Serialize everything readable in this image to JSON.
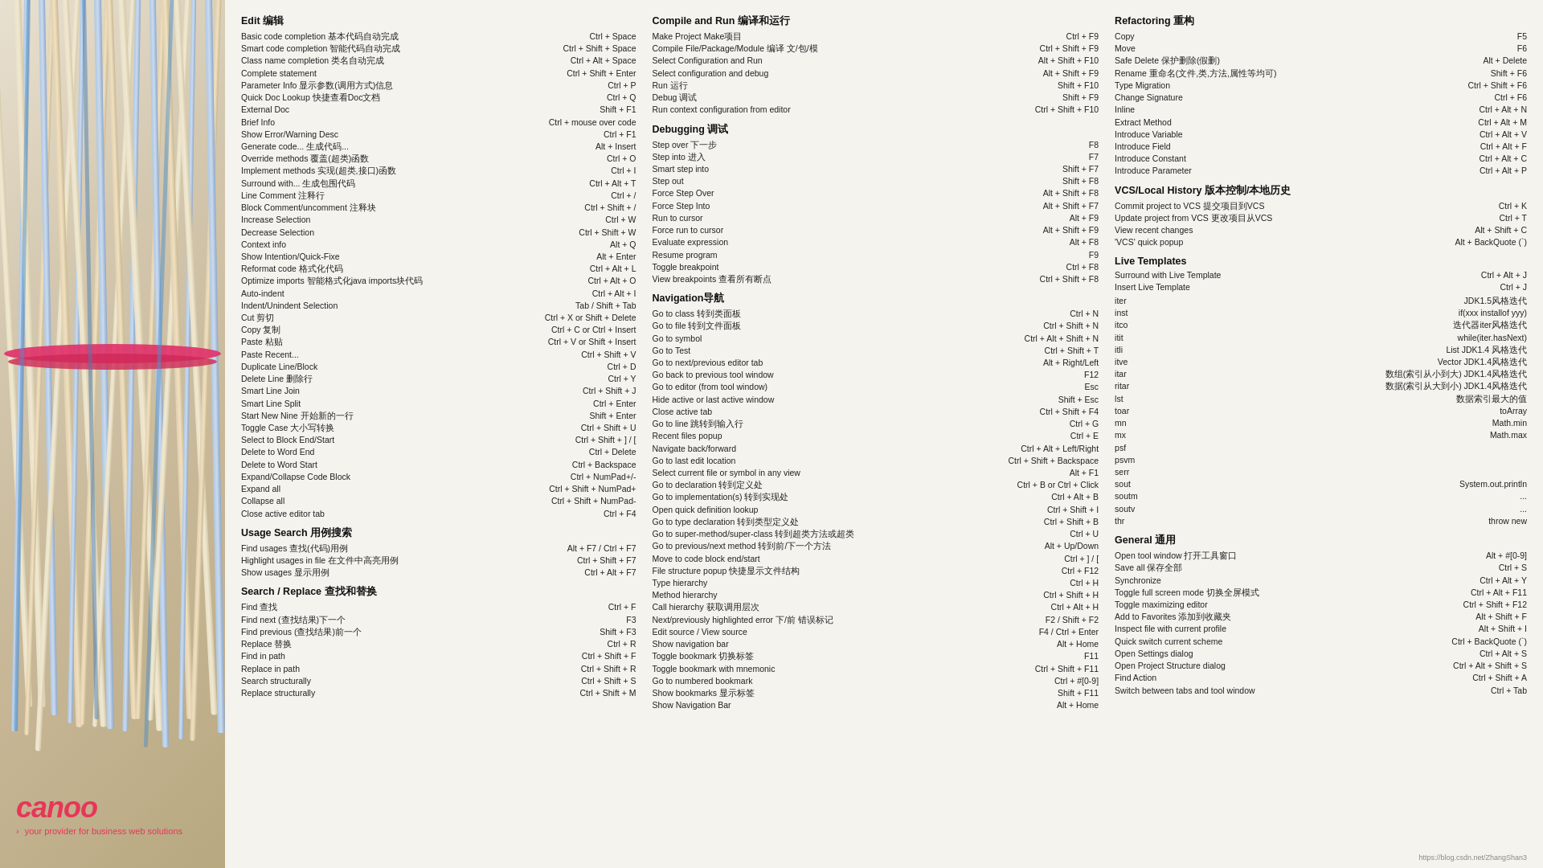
{
  "logo": {
    "text": "canoo",
    "tagline": "your provider for business web solutions",
    "arrow": "›"
  },
  "url": "https://blog.csdn.net/ZhangShan3",
  "columns": {
    "col1": {
      "title": "Edit 编辑",
      "items": [
        {
          "desc": "Basic code completion  基本代码自动完成",
          "key": "Ctrl + Space"
        },
        {
          "desc": "Smart code completion  智能代码自动完成",
          "key": "Ctrl + Shift + Space"
        },
        {
          "desc": "Class name completion  类名自动完成",
          "key": "Ctrl + Alt + Space"
        },
        {
          "desc": "Complete statement",
          "key": "Ctrl + Shift + Enter"
        },
        {
          "desc": "Parameter Info  显示参数(调用方式)信息",
          "key": "Ctrl + P"
        },
        {
          "desc": "Quick Doc Lookup  快捷查看Doc文档",
          "key": "Ctrl + Q"
        },
        {
          "desc": "External Doc",
          "key": "Shift + F1"
        },
        {
          "desc": "Brief Info",
          "key": "Ctrl + mouse over code"
        },
        {
          "desc": "Show Error/Warning Desc",
          "key": "Ctrl + F1"
        },
        {
          "desc": "Generate code...  生成代码...",
          "key": "Alt + Insert"
        },
        {
          "desc": "Override methods  覆盖(超类)函数",
          "key": "Ctrl + O"
        },
        {
          "desc": "Implement methods  实现(超类,接口)函数",
          "key": "Ctrl + I"
        },
        {
          "desc": "Surround with...  生成包围代码",
          "key": "Ctrl + Alt + T"
        },
        {
          "desc": "Line Comment  注释行",
          "key": "Ctrl + /"
        },
        {
          "desc": "Block Comment/uncomment  注释块",
          "key": "Ctrl + Shift + /"
        },
        {
          "desc": "Increase Selection",
          "key": "Ctrl + W"
        },
        {
          "desc": "Decrease Selection",
          "key": "Ctrl + Shift + W"
        },
        {
          "desc": "Context info",
          "key": "Alt + Q"
        },
        {
          "desc": "Show Intention/Quick-Fixe",
          "key": "Alt + Enter"
        },
        {
          "desc": "Reformat code  格式化代码",
          "key": "Ctrl + Alt + L"
        },
        {
          "desc": "Optimize imports  智能格式化java imports块代码",
          "key": "Ctrl + Alt + O"
        },
        {
          "desc": "Auto-indent",
          "key": "Ctrl + Alt + I"
        },
        {
          "desc": "Indent/Unindent Selection",
          "key": "Tab / Shift + Tab"
        },
        {
          "desc": "Cut  剪切",
          "key": "Ctrl + X or Shift + Delete"
        },
        {
          "desc": "Copy  复制",
          "key": "Ctrl + C or Ctrl + Insert"
        },
        {
          "desc": "Paste  粘贴",
          "key": "Ctrl + V or Shift + Insert"
        },
        {
          "desc": "Paste Recent...",
          "key": "Ctrl + Shift + V"
        },
        {
          "desc": "Duplicate Line/Block",
          "key": "Ctrl + D"
        },
        {
          "desc": "Delete Line  删除行",
          "key": "Ctrl + Y"
        },
        {
          "desc": "Smart Line Join",
          "key": "Ctrl + Shift + J"
        },
        {
          "desc": "Smart Line Split",
          "key": "Ctrl + Enter"
        },
        {
          "desc": "Start New Nine  开始新的一行",
          "key": "Shift + Enter"
        },
        {
          "desc": "Toggle Case  大小写转换",
          "key": "Ctrl + Shift + U"
        },
        {
          "desc": "Select to Block End/Start",
          "key": "Ctrl + Shift + ] / ["
        },
        {
          "desc": "Delete to Word End",
          "key": "Ctrl + Delete"
        },
        {
          "desc": "Delete to Word Start",
          "key": "Ctrl + Backspace"
        },
        {
          "desc": "Expand/Collapse Code Block",
          "key": "Ctrl + NumPad+/-"
        },
        {
          "desc": "Expand all",
          "key": "Ctrl + Shift + NumPad+"
        },
        {
          "desc": "Collapse all",
          "key": "Ctrl + Shift + NumPad-"
        },
        {
          "desc": "Close active editor tab",
          "key": "Ctrl + F4"
        }
      ],
      "usage_title": "Usage Search 用例搜索",
      "usage_items": [
        {
          "desc": "Find usages  查找(代码)用例",
          "key": "Alt + F7 / Ctrl + F7"
        },
        {
          "desc": "Highlight usages in file  在文件中高亮用例",
          "key": "Ctrl + Shift + F7"
        },
        {
          "desc": "Show usages  显示用例",
          "key": "Ctrl + Alt + F7"
        }
      ],
      "search_title": "Search / Replace 查找和替换",
      "search_items": [
        {
          "desc": "Find  查找",
          "key": "Ctrl + F"
        },
        {
          "desc": "Find next  (查找结果)下一个",
          "key": "F3"
        },
        {
          "desc": "Find previous  (查找结果)前一个",
          "key": "Shift + F3"
        },
        {
          "desc": "Replace  替换",
          "key": "Ctrl + R"
        },
        {
          "desc": "Find in path",
          "key": "Ctrl + Shift + F"
        },
        {
          "desc": "Replace in path",
          "key": "Ctrl + Shift + R"
        },
        {
          "desc": "Search structurally",
          "key": "Ctrl + Shift + S"
        },
        {
          "desc": "Replace structurally",
          "key": "Ctrl + Shift + M"
        }
      ]
    },
    "col2": {
      "compile_title": "Compile and Run 编译和运行",
      "compile_items": [
        {
          "desc": "Make Project  Make项目",
          "key": "Ctrl + F9"
        },
        {
          "desc": "Compile File/Package/Module  编译 文/包/模",
          "key": "Ctrl + Shift + F9"
        },
        {
          "desc": "Select Configuration and Run",
          "key": "Alt + Shift + F10"
        },
        {
          "desc": "Select configuration and debug",
          "key": "Alt + Shift + F9"
        },
        {
          "desc": "Run  运行",
          "key": "Shift + F10"
        },
        {
          "desc": "Debug  调试",
          "key": "Shift + F9"
        },
        {
          "desc": "Run context configuration from editor",
          "key": "Ctrl + Shift + F10"
        }
      ],
      "debug_title": "Debugging 调试",
      "debug_items": [
        {
          "desc": "Step over  下一步",
          "key": "F8"
        },
        {
          "desc": "Step into  进入",
          "key": "F7"
        },
        {
          "desc": "Smart step into",
          "key": "Shift + F7"
        },
        {
          "desc": "Step out",
          "key": "Shift + F8"
        },
        {
          "desc": "Force Step Over",
          "key": "Alt + Shift + F8"
        },
        {
          "desc": "Force Step Into",
          "key": "Alt + Shift + F7"
        },
        {
          "desc": "Run to cursor",
          "key": "Alt + F9"
        },
        {
          "desc": "Force run to cursor",
          "key": "Alt + Shift + F9"
        },
        {
          "desc": "Evaluate expression",
          "key": "Alt + F8"
        },
        {
          "desc": "Resume program",
          "key": "F9"
        },
        {
          "desc": "Toggle breakpoint",
          "key": "Ctrl + F8"
        },
        {
          "desc": "View breakpoints  查看所有断点",
          "key": "Ctrl + Shift + F8"
        }
      ],
      "nav_title": "Navigation导航",
      "nav_items": [
        {
          "desc": "Go to class  转到类面板",
          "key": "Ctrl + N"
        },
        {
          "desc": "Go to file  转到文件面板",
          "key": "Ctrl + Shift + N"
        },
        {
          "desc": "Go to symbol",
          "key": "Ctrl + Alt + Shift + N"
        },
        {
          "desc": "Go to Test",
          "key": "Ctrl + Shift + T"
        },
        {
          "desc": "Go to next/previous editor tab",
          "key": "Alt + Right/Left"
        },
        {
          "desc": "Go back to previous tool window",
          "key": "F12"
        },
        {
          "desc": "Go to editor (from tool window)",
          "key": "Esc"
        },
        {
          "desc": "Hide active or last active window",
          "key": "Shift + Esc"
        },
        {
          "desc": "Close active tab",
          "key": "Ctrl + Shift + F4"
        },
        {
          "desc": "Go to line  跳转到输入行",
          "key": "Ctrl + G"
        },
        {
          "desc": "Recent files popup",
          "key": "Ctrl + E"
        },
        {
          "desc": "Navigate back/forward",
          "key": "Ctrl + Alt + Left/Right"
        },
        {
          "desc": "Go to last edit location",
          "key": "Ctrl + Shift + Backspace"
        },
        {
          "desc": "Select current file or symbol in any view",
          "key": "Alt + F1"
        },
        {
          "desc": "Go to declaration  转到定义处",
          "key": "Ctrl + B or Ctrl + Click"
        },
        {
          "desc": "Go to implementation(s)  转到实现处",
          "key": "Ctrl + Alt + B"
        },
        {
          "desc": "Open quick definition lookup",
          "key": "Ctrl + Shift + I"
        },
        {
          "desc": "Go to type declaration  转到类型定义处",
          "key": "Ctrl + Shift + B"
        },
        {
          "desc": "Go to super-method/super-class  转到超类方法或超类",
          "key": "Ctrl + U"
        },
        {
          "desc": "Go to previous/next method  转到前/下一个方法",
          "key": "Alt + Up/Down"
        },
        {
          "desc": "Move to code block end/start",
          "key": "Ctrl + ] / ["
        },
        {
          "desc": "File structure popup  快捷显示文件结构",
          "key": "Ctrl + F12"
        },
        {
          "desc": "Type hierarchy",
          "key": "Ctrl + H"
        },
        {
          "desc": "Method hierarchy",
          "key": "Ctrl + Shift + H"
        },
        {
          "desc": "Call hierarchy  获取调用层次",
          "key": "Ctrl + Alt + H"
        },
        {
          "desc": "Next/previously highlighted error  下/前 错误标记",
          "key": "F2 / Shift + F2"
        },
        {
          "desc": "Edit source / View source",
          "key": "F4 / Ctrl + Enter"
        },
        {
          "desc": "Show navigation bar",
          "key": "Alt + Home"
        },
        {
          "desc": "Toggle bookmark  切换标签",
          "key": "F11"
        },
        {
          "desc": "Toggle bookmark with mnemonic",
          "key": "Ctrl + Shift + F11"
        },
        {
          "desc": "Go to numbered bookmark",
          "key": "Ctrl + #[0-9]"
        },
        {
          "desc": "Show bookmarks  显示标签",
          "key": "Shift + F11"
        },
        {
          "desc": "Show Navigation Bar",
          "key": "Alt + Home"
        }
      ]
    },
    "col3": {
      "refactor_title": "Refactoring 重构",
      "refactor_items": [
        {
          "desc": "Copy",
          "key": "F5"
        },
        {
          "desc": "Move",
          "key": "F6"
        },
        {
          "desc": "Safe Delete  保护删除(假删)",
          "key": "Alt + Delete"
        },
        {
          "desc": "Rename  重命名(文件,类,方法,属性等均可)",
          "key": "Shift + F6"
        },
        {
          "desc": "Type Migration",
          "key": "Ctrl + Shift + F6"
        },
        {
          "desc": "Change Signature",
          "key": "Ctrl + F6"
        },
        {
          "desc": "Inline",
          "key": "Ctrl + Alt + N"
        },
        {
          "desc": "Extract Method",
          "key": "Ctrl + Alt + M"
        },
        {
          "desc": "Introduce Variable",
          "key": "Ctrl + Alt + V"
        },
        {
          "desc": "Introduce Field",
          "key": "Ctrl + Alt + F"
        },
        {
          "desc": "Introduce Constant",
          "key": "Ctrl + Alt + C"
        },
        {
          "desc": "Introduce Parameter",
          "key": "Ctrl + Alt + P"
        }
      ],
      "vcs_title": "VCS/Local History 版本控制/本地历史",
      "vcs_items": [
        {
          "desc": "Commit project to VCS  提交项目到VCS",
          "key": "Ctrl + K"
        },
        {
          "desc": "Update project from VCS  更改项目从VCS",
          "key": "Ctrl + T"
        },
        {
          "desc": "View recent changes",
          "key": "Alt + Shift + C"
        },
        {
          "desc": "'VCS' quick popup",
          "key": "Alt + BackQuote (`)"
        }
      ],
      "live_title": "Live Templates",
      "live_items": [
        {
          "desc": "Surround with Live Template",
          "key": "Ctrl + Alt + J"
        },
        {
          "desc": "Insert Live Template",
          "key": "Ctrl + J"
        }
      ],
      "templates": [
        {
          "abbr": "iter",
          "desc": "JDK1.5风格迭代  if(xxx installof yyy)"
        },
        {
          "abbr": "inst",
          "desc": ""
        },
        {
          "abbr": "itco",
          "desc": "迭代器iter风格迭代"
        },
        {
          "abbr": "itit",
          "desc": "while(iter.hasNext)"
        },
        {
          "abbr": "itli",
          "desc": "List JDK1.4 风格迭代"
        },
        {
          "abbr": "itve",
          "desc": "Vector JDK1.4风格迭代"
        },
        {
          "abbr": "itar",
          "desc": "数组(索引从小到大) JDK1.4风格迭代"
        },
        {
          "abbr": "ritar",
          "desc": "数据(索引从大到小) JDK1.4风格迭代"
        },
        {
          "abbr": "lst",
          "desc": "数据索引最大的值"
        },
        {
          "abbr": "toar",
          "desc": "toArray"
        },
        {
          "abbr": "mn",
          "desc": "Math.min"
        },
        {
          "abbr": "mx",
          "desc": "Math.max"
        },
        {
          "abbr": "psf",
          "desc": ""
        },
        {
          "abbr": "psvm",
          "desc": ""
        },
        {
          "abbr": "serr",
          "desc": ""
        },
        {
          "abbr": "sout",
          "desc": "System.out.println"
        },
        {
          "abbr": "soutm",
          "desc": "..."
        },
        {
          "abbr": "soutv",
          "desc": "..."
        },
        {
          "abbr": "thr",
          "desc": "throw new"
        }
      ],
      "general_title": "General 通用",
      "general_items": [
        {
          "desc": "Open tool window  打开工具窗口",
          "key": "Alt + #[0-9]"
        },
        {
          "desc": "Save all  保存全部",
          "key": "Ctrl + S"
        },
        {
          "desc": "Synchronize",
          "key": "Ctrl + Alt + Y"
        },
        {
          "desc": "Toggle full screen mode  切换全屏模式",
          "key": "Ctrl + Alt + F11"
        },
        {
          "desc": "Toggle maximizing editor",
          "key": "Ctrl + Shift + F12"
        },
        {
          "desc": "Add to Favorites  添加到收藏夹",
          "key": "Alt + Shift + F"
        },
        {
          "desc": "Inspect file with current profile",
          "key": "Alt + Shift + I"
        },
        {
          "desc": "Quick switch current scheme",
          "key": "Ctrl + BackQuote (`)"
        },
        {
          "desc": "Open Settings dialog",
          "key": "Ctrl + Alt + S"
        },
        {
          "desc": "Open Project Structure dialog",
          "key": "Ctrl + Alt + Shift + S"
        },
        {
          "desc": "Find Action",
          "key": "Ctrl + Shift + A"
        },
        {
          "desc": "Switch between tabs and tool window",
          "key": "Ctrl + Tab"
        }
      ]
    }
  }
}
